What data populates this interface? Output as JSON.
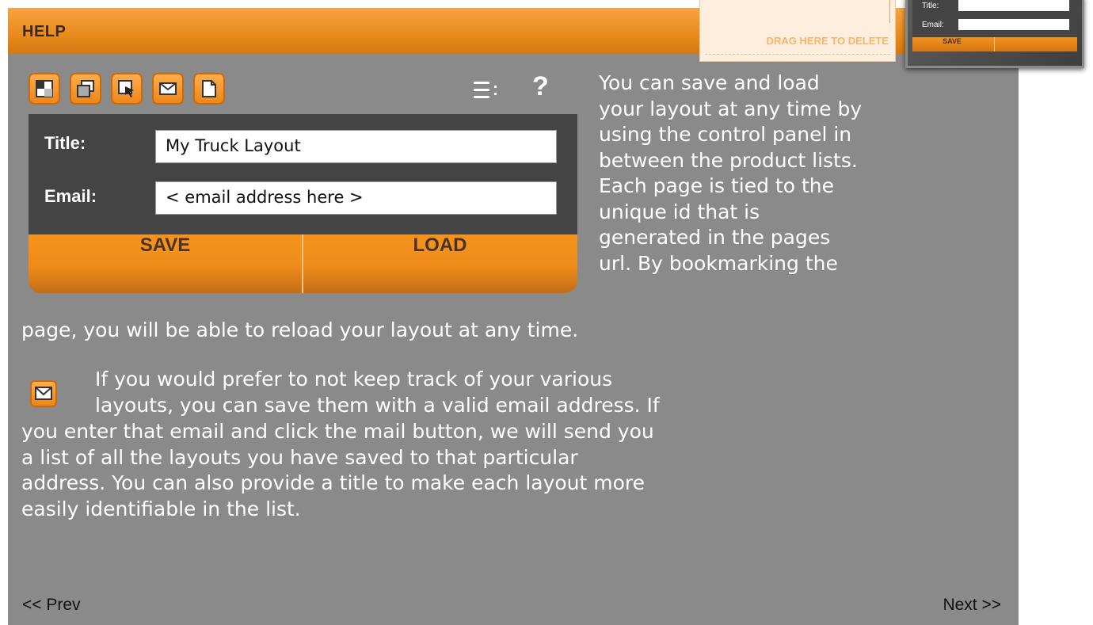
{
  "dialog": {
    "title": "HELP",
    "panel": {
      "toolbar": [
        "layout-icon",
        "copy-icon",
        "select-icon",
        "mail-icon",
        "new-page-icon"
      ],
      "help": "?",
      "title_label": "Title:",
      "title_value": "My Truck Layout",
      "email_label": "Email:",
      "email_value": "< email address here >",
      "save_label": "SAVE",
      "load_label": "LOAD"
    },
    "para1_lines": [
      "You can save and load",
      "your layout at any time by",
      "using the control panel in",
      "between the product lists.",
      "Each page is tied to the",
      "unique id that is",
      "generated in the pages",
      "url. By bookmarking the"
    ],
    "para1_full": "page, you will be able to reload your layout at any time.",
    "para2_lines": [
      "If you would prefer to not keep track of your various",
      "layouts, you can save them with a valid email address. If",
      "you enter that email and click the mail button, we will send you",
      "a list of all the layouts you have saved to that particular",
      "address. You can also provide a title to make each layout more",
      "easily identifiable in the list."
    ],
    "prev": "<< Prev",
    "next": "Next >>"
  },
  "snippet": {
    "drop_label": "DRAG HERE TO DELETE",
    "mini_title_label": "Title:",
    "mini_email_label": "Email:",
    "mini_save_label": "SAVE"
  },
  "colors": {
    "accent_orange": "#ee8c19",
    "dialog_gray": "#8a8a8a",
    "form_dark": "#444444"
  }
}
